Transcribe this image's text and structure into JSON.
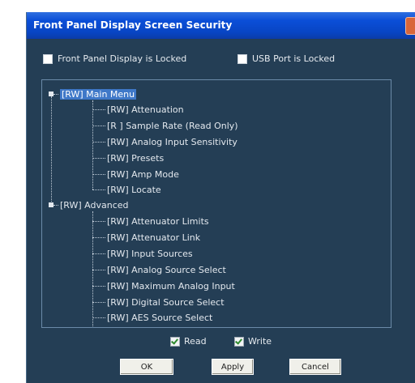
{
  "window": {
    "title": "Front Panel Display Screen Security"
  },
  "options": {
    "front_panel_locked": "Front Panel Display is Locked",
    "usb_locked": "USB Port is Locked"
  },
  "tree": {
    "groups": [
      {
        "label": "[RW] Main Menu",
        "items": [
          "[RW] Attenuation",
          "[R   ] Sample Rate (Read Only)",
          "[RW] Analog Input Sensitivity",
          "[RW] Presets",
          "[RW] Amp Mode",
          "[RW] Locate"
        ]
      },
      {
        "label": "[RW] Advanced",
        "items": [
          "[RW] Attenuator Limits",
          "[RW] Attenuator Link",
          "[RW] Input Sources",
          "[RW] Analog Source Select",
          "[RW] Maximum Analog Input",
          "[RW] Digital Source Select",
          "[RW] AES Source Select"
        ]
      }
    ]
  },
  "permissions": {
    "read": "Read",
    "write": "Write"
  },
  "buttons": {
    "ok": "OK",
    "apply": "Apply",
    "cancel": "Cancel"
  }
}
